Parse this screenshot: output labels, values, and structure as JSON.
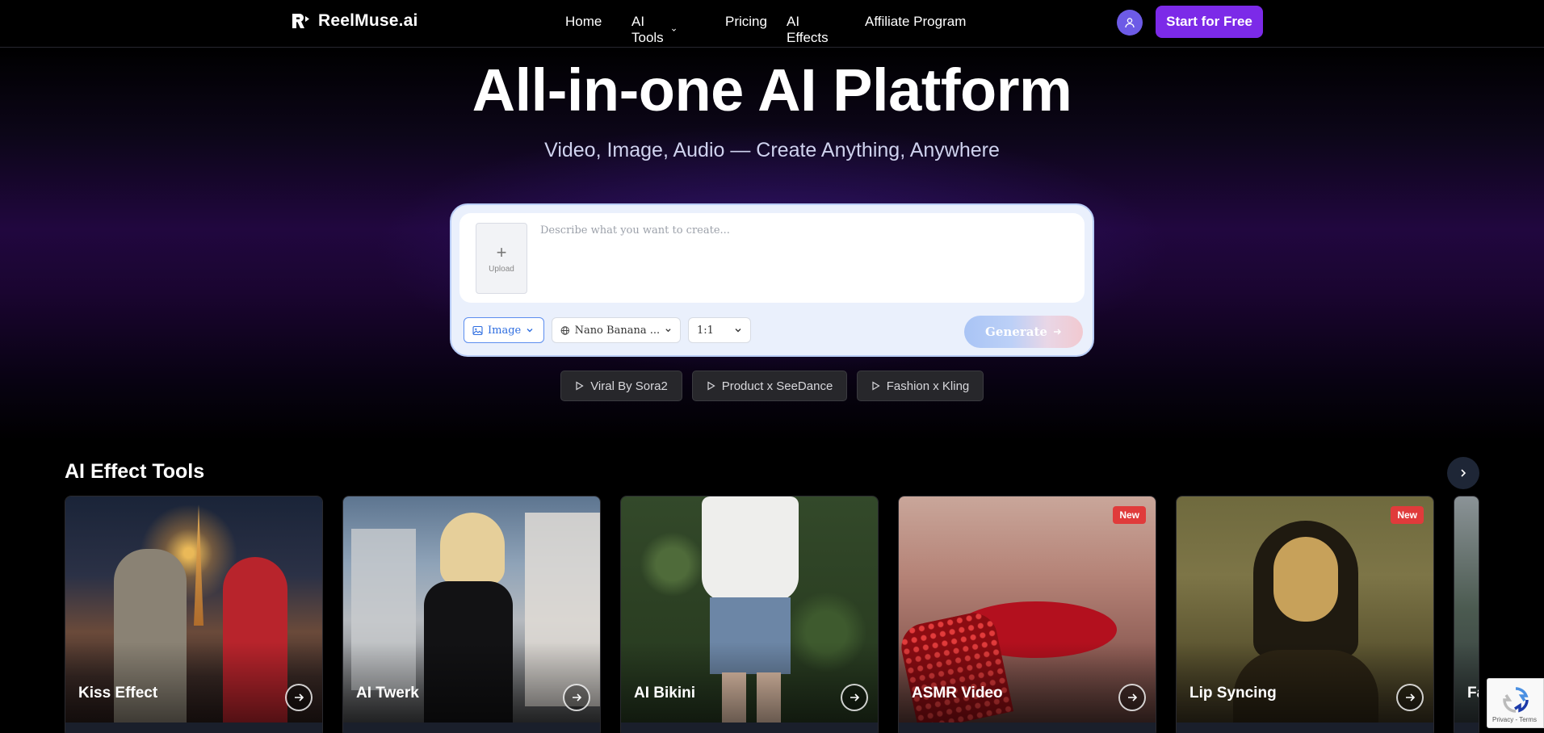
{
  "nav": {
    "logo_text": "ReelMuse.ai",
    "links": [
      {
        "label": "Home"
      },
      {
        "label": "AI Tools"
      },
      {
        "label": "Pricing"
      },
      {
        "label": "AI Effects"
      },
      {
        "label": "Affiliate Program"
      }
    ],
    "cta_label": "Start for Free"
  },
  "hero": {
    "title": "All-in-one AI Platform",
    "subtitle": "Video, Image, Audio — Create Anything, Anywhere"
  },
  "prompt": {
    "upload_label": "Upload",
    "placeholder": "Describe what you want to create...",
    "type_value": "Image",
    "model_value": "Nano Banana ...",
    "ratio_value": "1:1",
    "generate_label": "Generate"
  },
  "chips": [
    {
      "label": "Viral By Sora2"
    },
    {
      "label": "Product x SeeDance"
    },
    {
      "label": "Fashion x Kling"
    }
  ],
  "effects": {
    "title": "AI Effect Tools",
    "cards": [
      {
        "title": "Kiss Effect",
        "badge": ""
      },
      {
        "title": "AI Twerk",
        "badge": ""
      },
      {
        "title": "AI Bikini",
        "badge": ""
      },
      {
        "title": "ASMR Video",
        "badge": "New"
      },
      {
        "title": "Lip Syncing",
        "badge": "New"
      },
      {
        "title": "Fa",
        "badge": ""
      }
    ]
  },
  "recaptcha": {
    "text": "Privacy - Terms"
  },
  "colors": {
    "accent": "#7c2ae8",
    "badge": "#e03b3b",
    "avatar": "#6d5be6"
  }
}
